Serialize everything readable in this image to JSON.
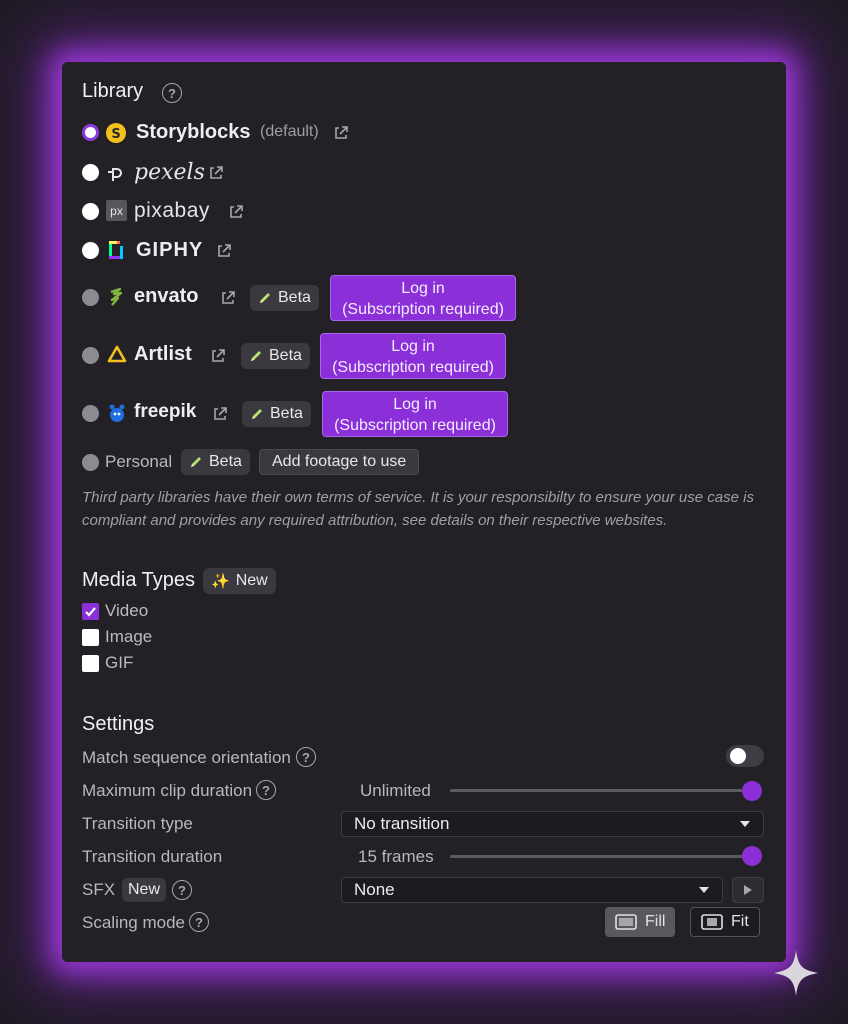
{
  "library": {
    "title": "Library",
    "help": "?",
    "options": [
      {
        "name": "Storyblocks",
        "suffix": "(default)",
        "selected": true,
        "icon": "storyblocks-logo-icon"
      },
      {
        "name": "pexels",
        "icon": "pexels-logo-icon"
      },
      {
        "name": "pixabay",
        "icon_text": "px",
        "icon": "pixabay-logo-icon"
      },
      {
        "name": "GIPHY",
        "icon": "giphy-logo-icon"
      },
      {
        "name": "envato",
        "badge": "Beta",
        "login": "Log in",
        "login_sub": "(Subscription required)",
        "icon": "envato-logo-icon"
      },
      {
        "name": "Artlist",
        "badge": "Beta",
        "login": "Log in",
        "login_sub": "(Subscription required)",
        "icon": "artlist-logo-icon"
      },
      {
        "name": "freepik",
        "badge": "Beta",
        "login": "Log in",
        "login_sub": "(Subscription required)",
        "icon": "freepik-logo-icon"
      },
      {
        "name": "Personal",
        "badge": "Beta",
        "action": "Add footage to use"
      }
    ],
    "note": "Third party libraries have their own terms of service. It is your responsibilty to ensure your use case is compliant and provides any required attribution, see details on their respective websites."
  },
  "media_types": {
    "title": "Media Types",
    "badge": "New",
    "items": [
      {
        "label": "Video",
        "checked": true
      },
      {
        "label": "Image",
        "checked": false
      },
      {
        "label": "GIF",
        "checked": false
      }
    ]
  },
  "settings": {
    "title": "Settings",
    "match_orientation": {
      "label": "Match sequence orientation",
      "on": false
    },
    "max_clip_duration": {
      "label": "Maximum clip duration",
      "value": "Unlimited",
      "level": 1.0
    },
    "transition_type": {
      "label": "Transition type",
      "value": "No transition"
    },
    "transition_duration": {
      "label": "Transition duration",
      "value": "15 frames",
      "level": 1.0
    },
    "sfx": {
      "label": "SFX",
      "badge": "New",
      "value": "None"
    },
    "scaling_mode": {
      "label": "Scaling mode",
      "fill": "Fill",
      "fit": "Fit",
      "selected": "Fill"
    }
  },
  "colors": {
    "accent": "#8b2fd9",
    "panel": "#232126",
    "background": "#1d1b21"
  }
}
